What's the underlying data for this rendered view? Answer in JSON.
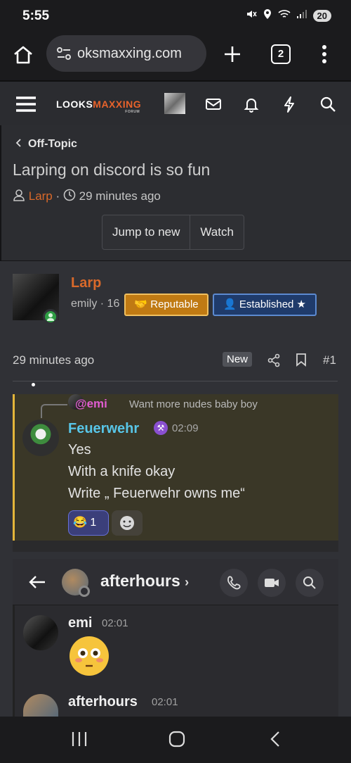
{
  "status_bar": {
    "time": "5:55",
    "battery": "20"
  },
  "browser": {
    "url": "oksmaxxing.com",
    "tab_count": "2"
  },
  "site": {
    "logo_part1": "LOOKS",
    "logo_part2": "MAXXING",
    "logo_sub": "FORUM"
  },
  "thread": {
    "breadcrumb": "Off-Topic",
    "title": "Larping on discord is so fun",
    "author": "Larp",
    "time": "29 minutes ago",
    "separator": "·",
    "jump_label": "Jump to new",
    "watch_label": "Watch"
  },
  "post": {
    "author": "Larp",
    "subtitle": "emily · 16",
    "badge_reputable": "Reputable",
    "badge_established": "Established ★",
    "time": "29 minutes ago",
    "new_label": "New",
    "number": "#1"
  },
  "discord_quote": {
    "reply_to": "@emi",
    "reply_text": "Want more nudes baby boy",
    "username": "Feuerwehr",
    "time": "02:09",
    "lines": [
      "Yes",
      "With a knife okay",
      "Write „ Feuerwehr owns me“"
    ],
    "reaction_count": "1"
  },
  "discord_chat": {
    "channel": "afterhours",
    "messages": [
      {
        "user": "emi",
        "time": "02:01"
      },
      {
        "user": "afterhours",
        "time": "02:01"
      }
    ]
  },
  "colors": {
    "accent": "#d9692a",
    "discord_name": "#58c6e8",
    "mention": "#e05cd0"
  }
}
